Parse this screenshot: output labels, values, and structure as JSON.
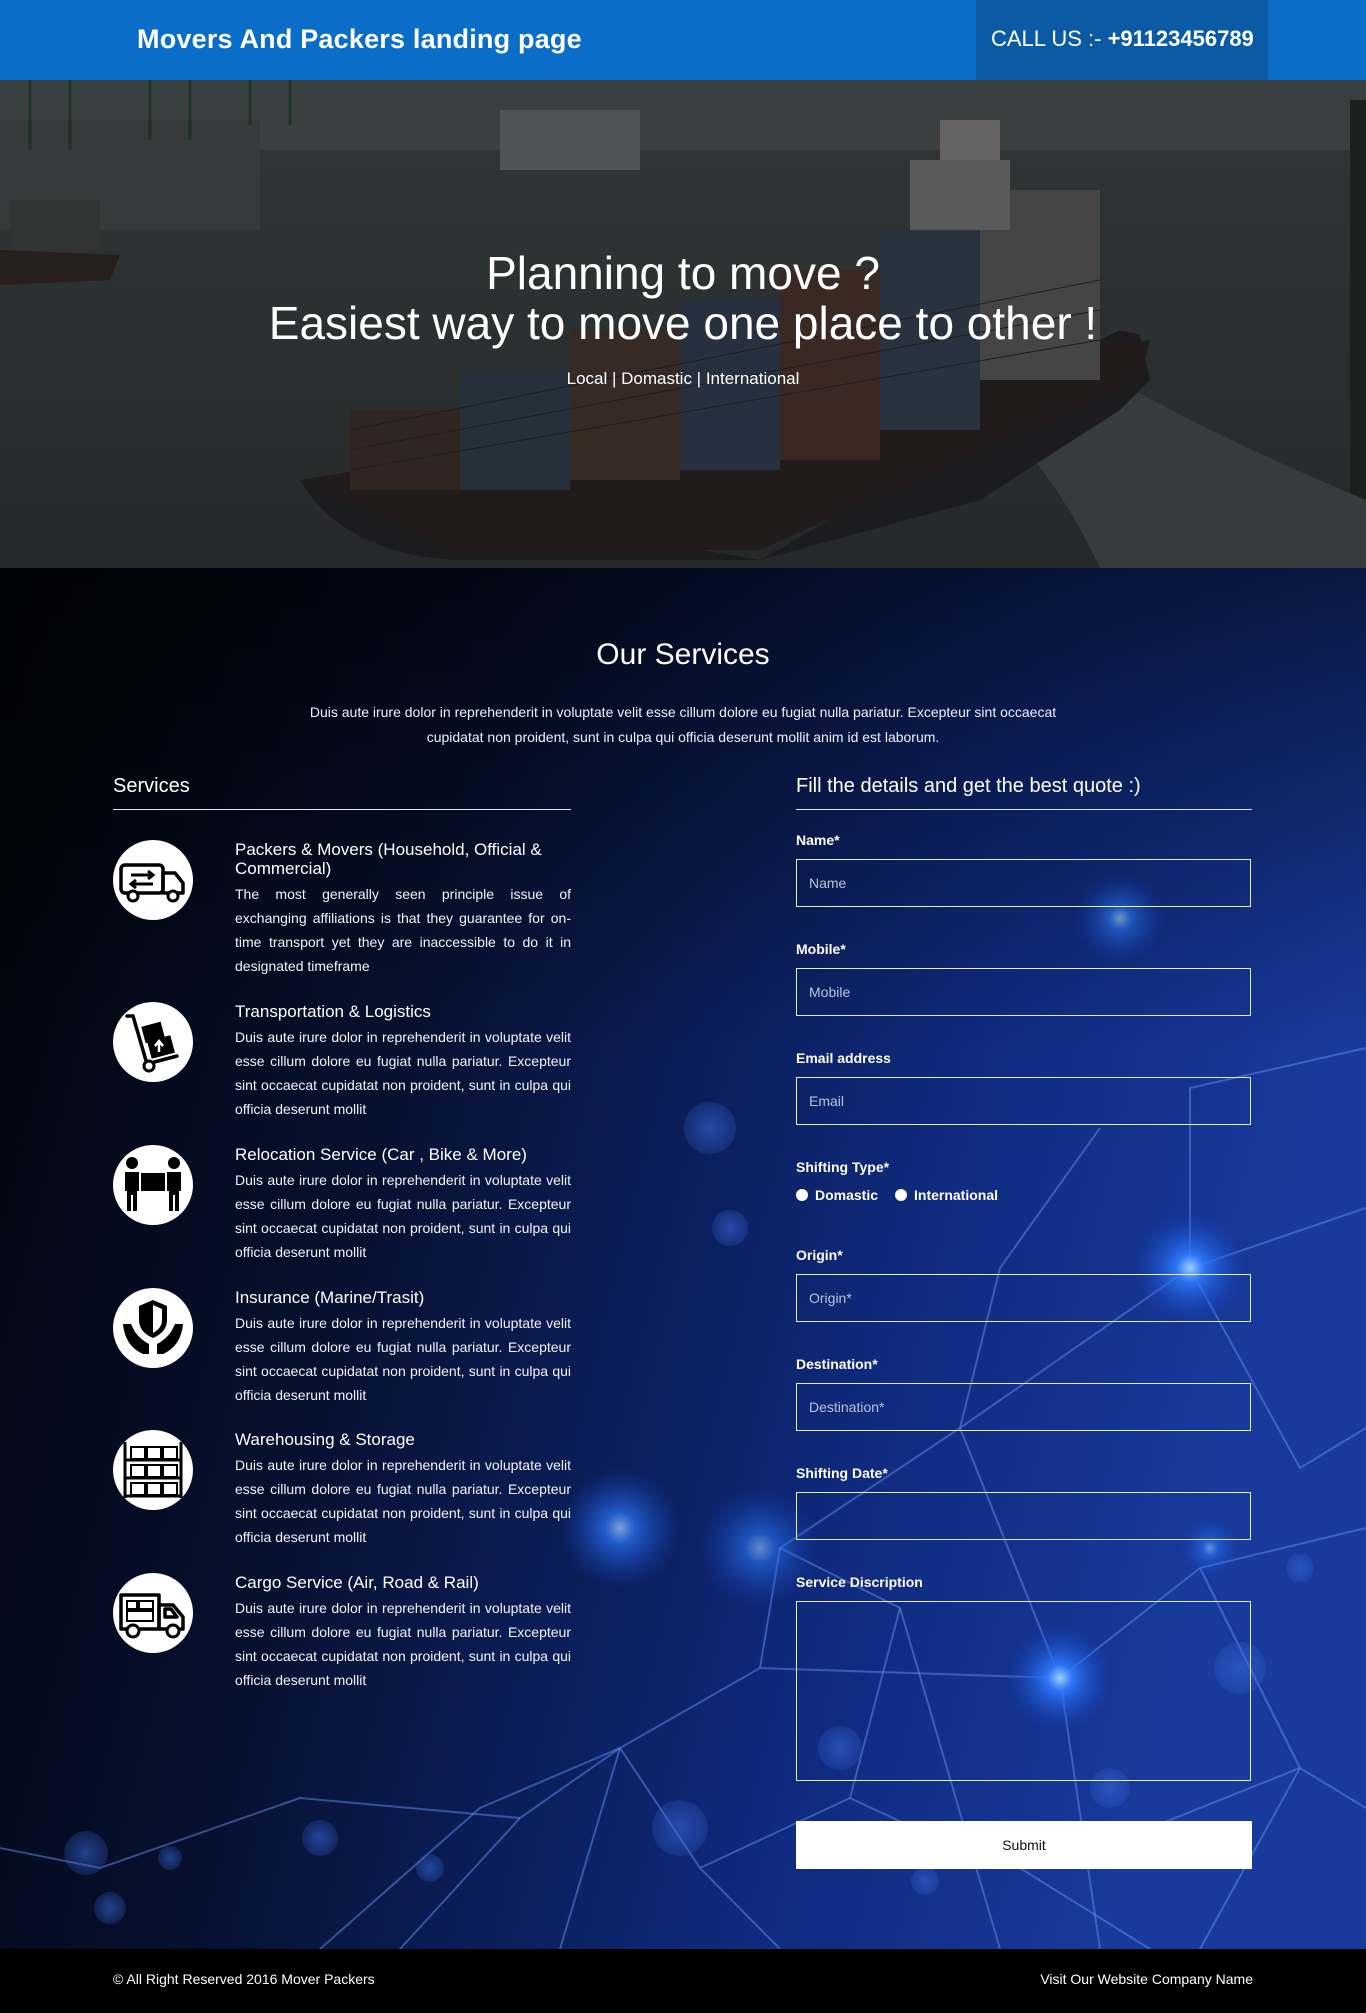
{
  "header": {
    "brand": "Movers And Packers landing page",
    "call_prefix": "CALL US :- ",
    "call_number": "+91123456789"
  },
  "hero": {
    "title_line1": "Planning to move ?",
    "title_line2": "Easiest way to move one place to other !",
    "subtitle": "Local | Domastic | International"
  },
  "services_section": {
    "title": "Our Services",
    "description": "Duis aute irure dolor in reprehenderit in voluptate velit esse cillum dolore eu fugiat nulla pariatur. Excepteur sint occaecat cupidatat non proident, sunt in culpa qui officia deserunt mollit anim id est laborum.",
    "list_heading": "Services",
    "items": [
      {
        "icon": "moving-truck-icon",
        "title": "Packers & Movers (Household, Official & Commercial)",
        "text": "The most generally seen principle issue of exchanging affiliations is that they guarantee for on-time transport yet they are inaccessible to do it in designated timeframe"
      },
      {
        "icon": "hand-truck-box-icon",
        "title": "Transportation & Logistics",
        "text": "Duis aute irure dolor in reprehenderit in voluptate velit esse cillum dolore eu fugiat nulla pariatur. Excepteur sint occaecat cupidatat non proident, sunt in culpa qui officia deserunt mollit"
      },
      {
        "icon": "people-carrying-box-icon",
        "title": "Relocation Service (Car , Bike & More)",
        "text": "Duis aute irure dolor in reprehenderit in voluptate velit esse cillum dolore eu fugiat nulla pariatur. Excepteur sint occaecat cupidatat non proident, sunt in culpa qui officia deserunt mollit"
      },
      {
        "icon": "shield-hands-icon",
        "title": "Insurance (Marine/Trasit)",
        "text": "Duis aute irure dolor in reprehenderit in voluptate velit esse cillum dolore eu fugiat nulla pariatur. Excepteur sint occaecat cupidatat non proident, sunt in culpa qui officia deserunt mollit"
      },
      {
        "icon": "warehouse-shelves-icon",
        "title": "Warehousing & Storage",
        "text": "Duis aute irure dolor in reprehenderit in voluptate velit esse cillum dolore eu fugiat nulla pariatur. Excepteur sint occaecat cupidatat non proident, sunt in culpa qui officia deserunt mollit"
      },
      {
        "icon": "cargo-truck-icon",
        "title": "Cargo Service (Air, Road & Rail)",
        "text": "Duis aute irure dolor in reprehenderit in voluptate velit esse cillum dolore eu fugiat nulla pariatur. Excepteur sint occaecat cupidatat non proident, sunt in culpa qui officia deserunt mollit"
      }
    ]
  },
  "form": {
    "heading": "Fill the details and get the best quote :)",
    "name_label": "Name*",
    "name_placeholder": "Name",
    "mobile_label": "Mobile*",
    "mobile_placeholder": "Mobile",
    "email_label": "Email address",
    "email_placeholder": "Email",
    "shifting_type_label": "Shifting Type*",
    "shifting_options": [
      "Domastic",
      "International"
    ],
    "origin_label": "Origin*",
    "origin_placeholder": "Origin*",
    "destination_label": "Destination*",
    "destination_placeholder": "Destination*",
    "date_label": "Shifting Date*",
    "description_label": "Service Discription",
    "submit_label": "Submit"
  },
  "footer": {
    "copyright": "© All Right Reserved 2016 Mover Packers",
    "link": "Visit Our Website Company Name"
  },
  "colors": {
    "header_blue": "#0a6ec8",
    "call_box_blue": "#0a5aa6",
    "section_dark": "#000000",
    "section_blue": "#14338f"
  }
}
